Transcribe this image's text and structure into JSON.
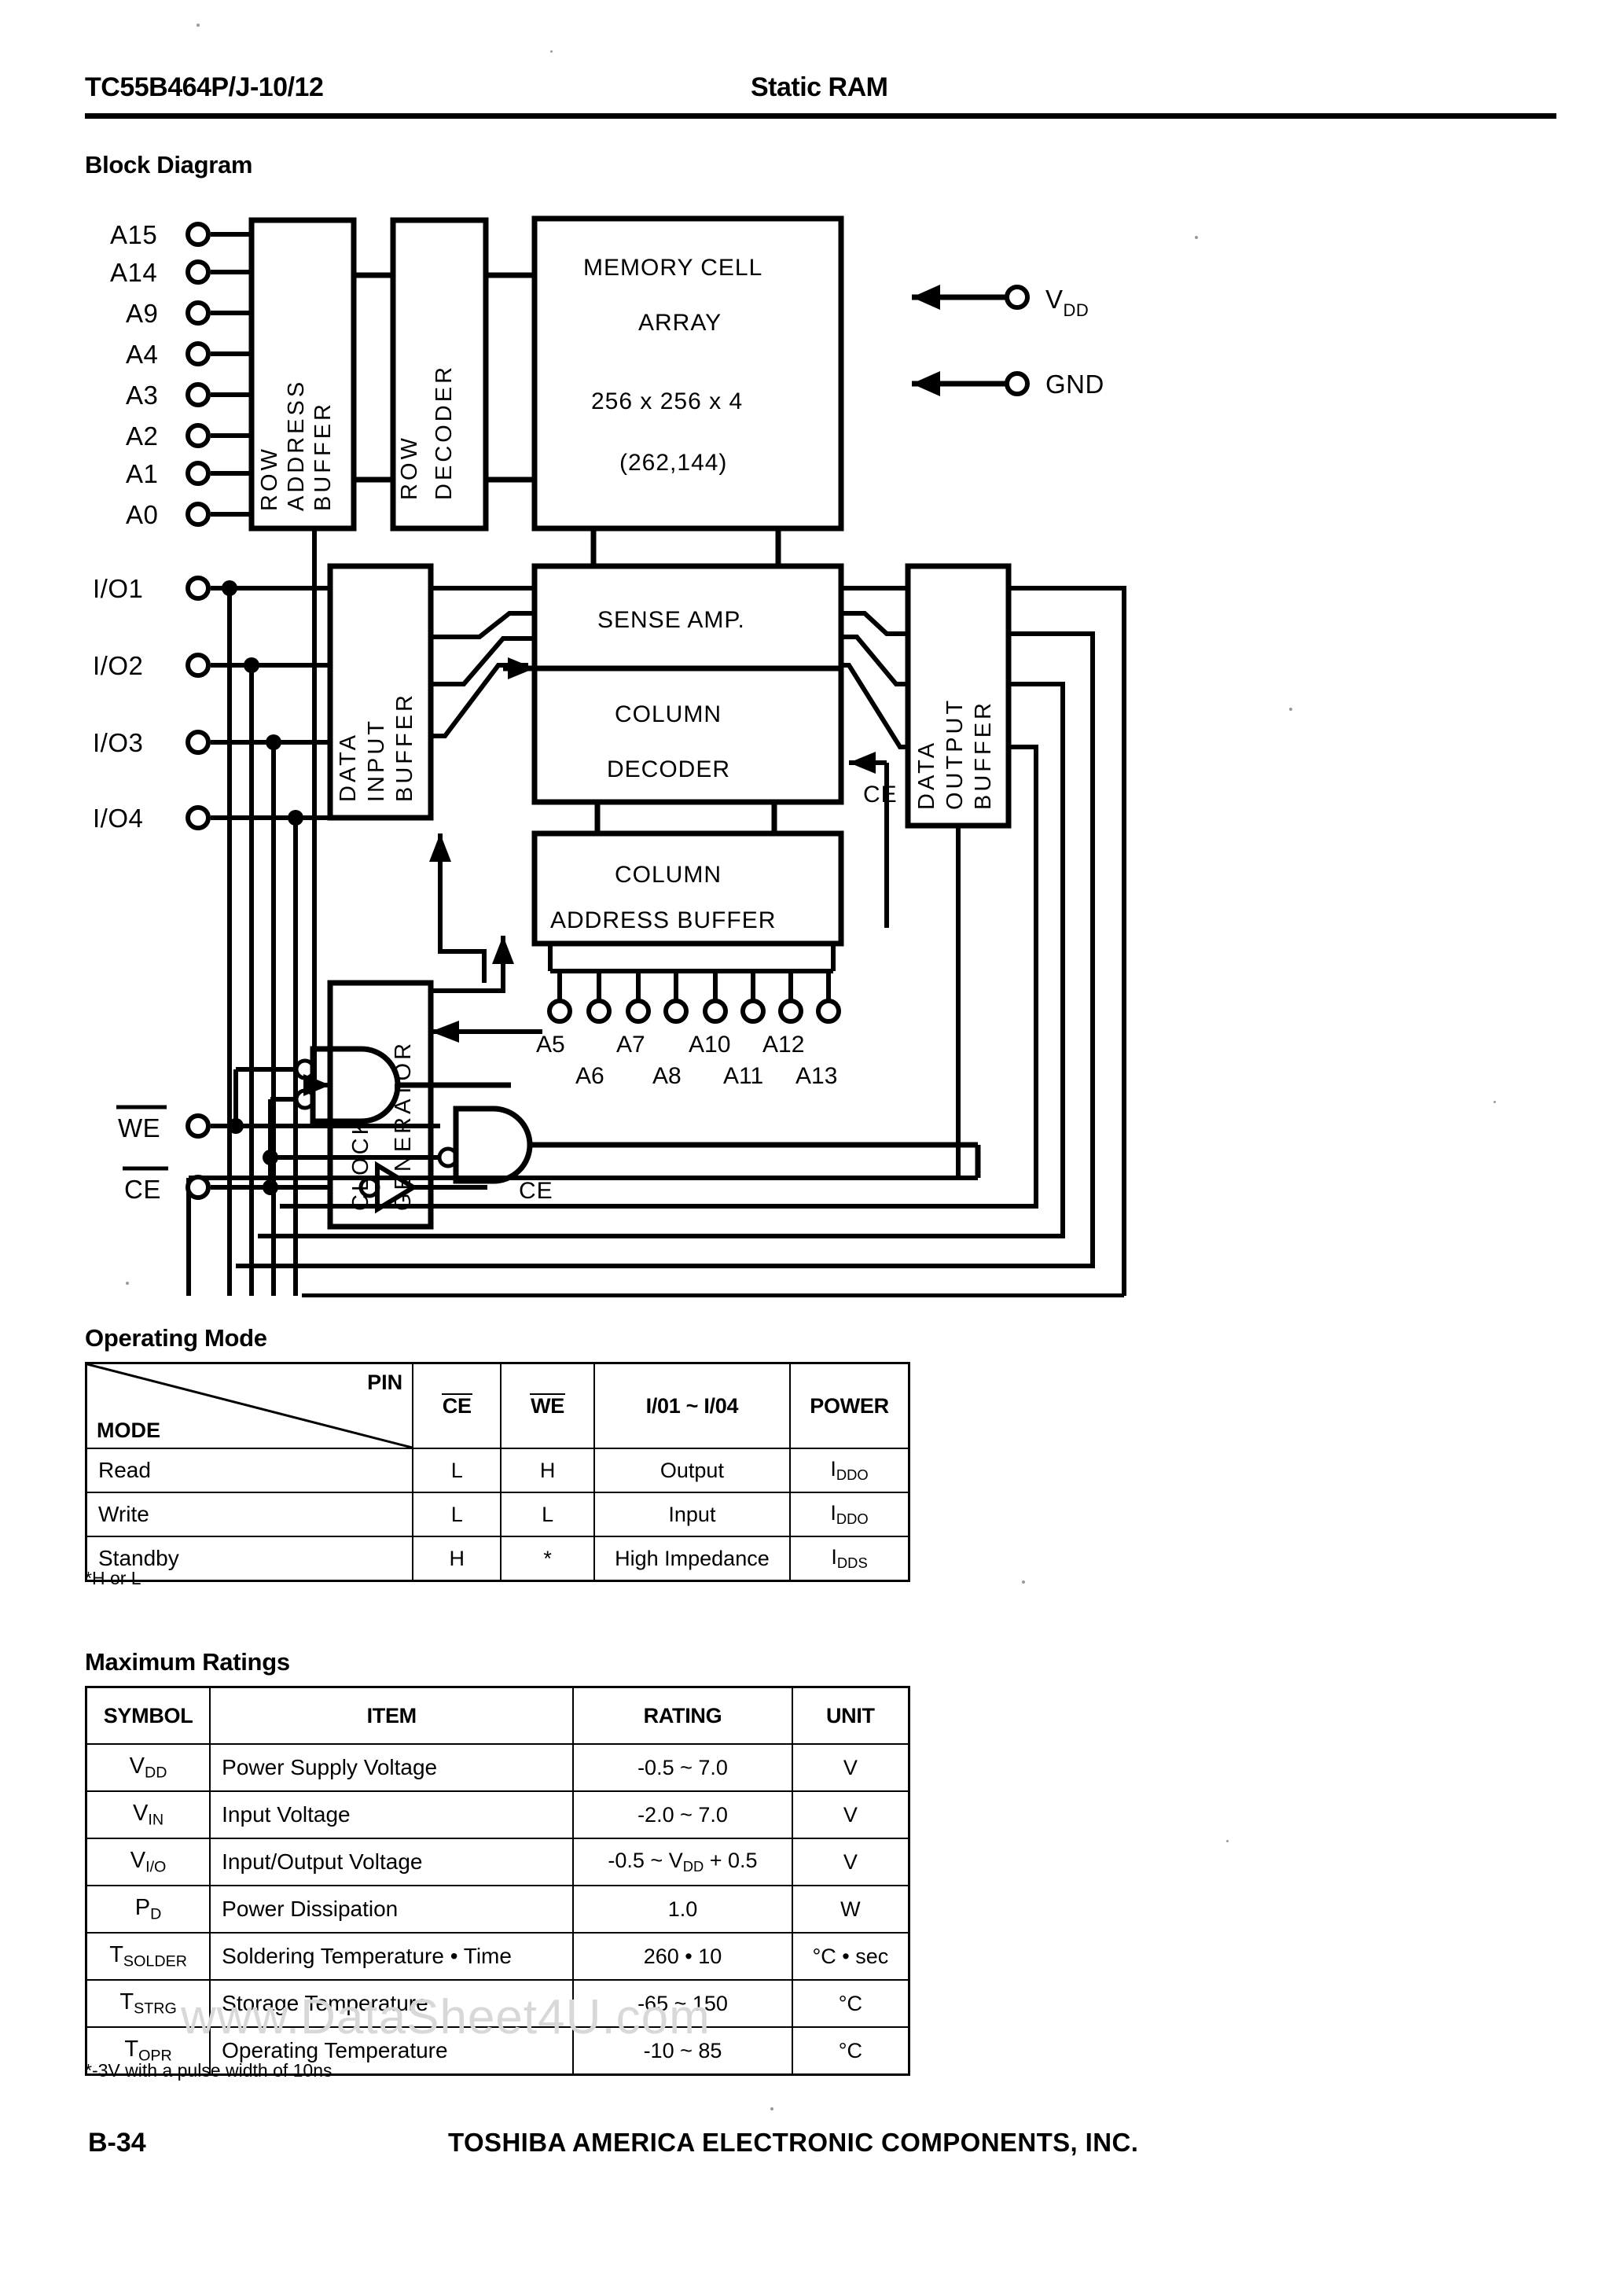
{
  "header": {
    "part_number": "TC55B464P/J-10/12",
    "device_type": "Static RAM"
  },
  "sections": {
    "block_diagram_title": "Block Diagram",
    "operating_mode_title": "Operating Mode",
    "maximum_ratings_title": "Maximum Ratings"
  },
  "block_diagram": {
    "row_address_pins": [
      "A15",
      "A14",
      "A9",
      "A4",
      "A3",
      "A2",
      "A1",
      "A0"
    ],
    "io_pins": [
      "I/O1",
      "I/O2",
      "I/O3",
      "I/O4"
    ],
    "column_address_pins_top": [
      "A5",
      "A7",
      "A10",
      "A12"
    ],
    "column_address_pins_bottom": [
      "A6",
      "A8",
      "A11",
      "A13"
    ],
    "power_pins": [
      {
        "label": "V",
        "sub": "DD"
      },
      {
        "label": "GND",
        "sub": ""
      }
    ],
    "control_pins": [
      {
        "label": "WE",
        "overline": true
      },
      {
        "label": "CE",
        "overline": true
      }
    ],
    "blocks": {
      "row_address_buffer": [
        "ROW",
        "ADDRESS",
        "BUFFER"
      ],
      "row_decoder": [
        "ROW",
        "DECODER"
      ],
      "memory_cell_array_line1": "MEMORY CELL",
      "memory_cell_array_line2": "ARRAY",
      "memory_cell_array_line3": "256 x 256 x 4",
      "memory_cell_array_line4": "(262,144)",
      "data_input_buffer": [
        "DATA",
        "INPUT",
        "BUFFER"
      ],
      "data_output_buffer": [
        "DATA",
        "OUTPUT",
        "BUFFER"
      ],
      "sense_amp": "SENSE AMP.",
      "column_decoder_line1": "COLUMN",
      "column_decoder_line2": "DECODER",
      "column_address_buffer_line1": "COLUMN",
      "column_address_buffer_line2": "ADDRESS BUFFER",
      "clock_generator": [
        "CLOCK",
        "GENERATOR"
      ]
    },
    "internal_signals": {
      "ce_right": "CE",
      "ce_bottom": "CE"
    }
  },
  "operating_mode_table": {
    "corner_pin_label": "PIN",
    "corner_mode_label": "MODE",
    "columns": [
      "CE",
      "WE",
      "I/01 ~ I/04",
      "POWER"
    ],
    "rows": [
      {
        "mode": "Read",
        "ce": "L",
        "we": "H",
        "io": "Output",
        "power_main": "I",
        "power_sub": "DDO"
      },
      {
        "mode": "Write",
        "ce": "L",
        "we": "L",
        "io": "Input",
        "power_main": "I",
        "power_sub": "DDO"
      },
      {
        "mode": "Standby",
        "ce": "H",
        "we": "*",
        "io": "High Impedance",
        "power_main": "I",
        "power_sub": "DDS"
      }
    ],
    "note": "*H or L"
  },
  "maximum_ratings_table": {
    "columns": [
      "SYMBOL",
      "ITEM",
      "RATING",
      "UNIT"
    ],
    "rows": [
      {
        "symbol_main": "V",
        "symbol_sub": "DD",
        "item": "Power Supply Voltage",
        "rating": "-0.5 ~ 7.0",
        "unit": "V"
      },
      {
        "symbol_main": "V",
        "symbol_sub": "IN",
        "item": "Input Voltage",
        "rating": "-2.0 ~ 7.0",
        "unit": "V"
      },
      {
        "symbol_main": "V",
        "symbol_sub": "I/O",
        "item": "Input/Output Voltage",
        "rating": "-0.5 ~ VDD + 0.5",
        "unit": "V"
      },
      {
        "symbol_main": "P",
        "symbol_sub": "D",
        "item": "Power Dissipation",
        "rating": "1.0",
        "unit": "W"
      },
      {
        "symbol_main": "T",
        "symbol_sub": "SOLDER",
        "item": "Soldering Temperature • Time",
        "rating": "260 • 10",
        "unit": "°C • sec"
      },
      {
        "symbol_main": "T",
        "symbol_sub": "STRG",
        "item": "Storage Temperature",
        "rating": "-65 ~ 150",
        "unit": "°C"
      },
      {
        "symbol_main": "T",
        "symbol_sub": "OPR",
        "item": "Operating Temperature",
        "rating": "-10 ~ 85",
        "unit": "°C"
      }
    ],
    "note": "*-3V with a pulse width of 10ns"
  },
  "watermark": "www.DataSheet4U.com",
  "footer": {
    "page_number": "B-34",
    "company": "TOSHIBA AMERICA ELECTRONIC COMPONENTS, INC."
  }
}
